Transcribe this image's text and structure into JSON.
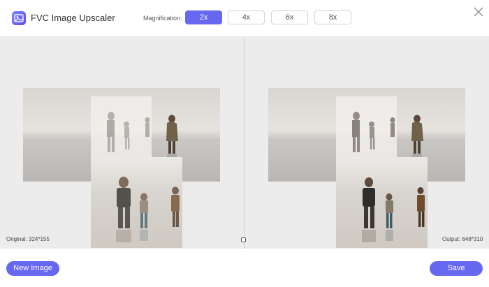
{
  "header": {
    "app_title": "FVC Image Upscaler",
    "magnification_label": "Magnification:",
    "magnification_options": [
      "2x",
      "4x",
      "6x",
      "8x"
    ],
    "selected_magnification": "2x"
  },
  "preview": {
    "original_label": "Original: 324*155",
    "output_label": "Output: 648*310"
  },
  "footer": {
    "new_image_label": "New Image",
    "save_label": "Save"
  },
  "colors": {
    "accent": "#6768f0",
    "background_area": "#ececec"
  },
  "icons": [
    "app-logo-icon",
    "close-icon",
    "compare-handle-icon"
  ]
}
